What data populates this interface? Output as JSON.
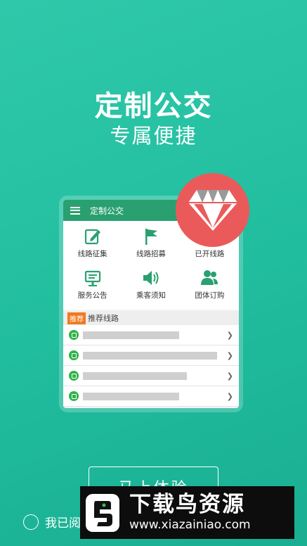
{
  "hero": {
    "title": "定制公交",
    "subtitle": "专属便捷"
  },
  "app": {
    "bar_title": "定制公交",
    "features": [
      {
        "label": "线路征集",
        "icon": "edit-icon"
      },
      {
        "label": "线路招募",
        "icon": "flag-icon"
      },
      {
        "label": "已开线路",
        "icon": "pin-icon"
      },
      {
        "label": "服务公告",
        "icon": "notice-board-icon"
      },
      {
        "label": "乘客须知",
        "icon": "speaker-icon"
      },
      {
        "label": "团体订购",
        "icon": "group-icon"
      }
    ],
    "recommend": {
      "badge": "推荐",
      "label": "推荐线路"
    }
  },
  "cta": {
    "label": "马上体验"
  },
  "agreement": {
    "label": "我已阅"
  },
  "watermark": {
    "name": "下载鸟资源",
    "url": "www.xiazainiao.com"
  },
  "colors": {
    "background": "#20bd9e",
    "app_bar": "#2aa070",
    "gem_circle": "#eb5a5a",
    "badge": "#f07a1f"
  }
}
